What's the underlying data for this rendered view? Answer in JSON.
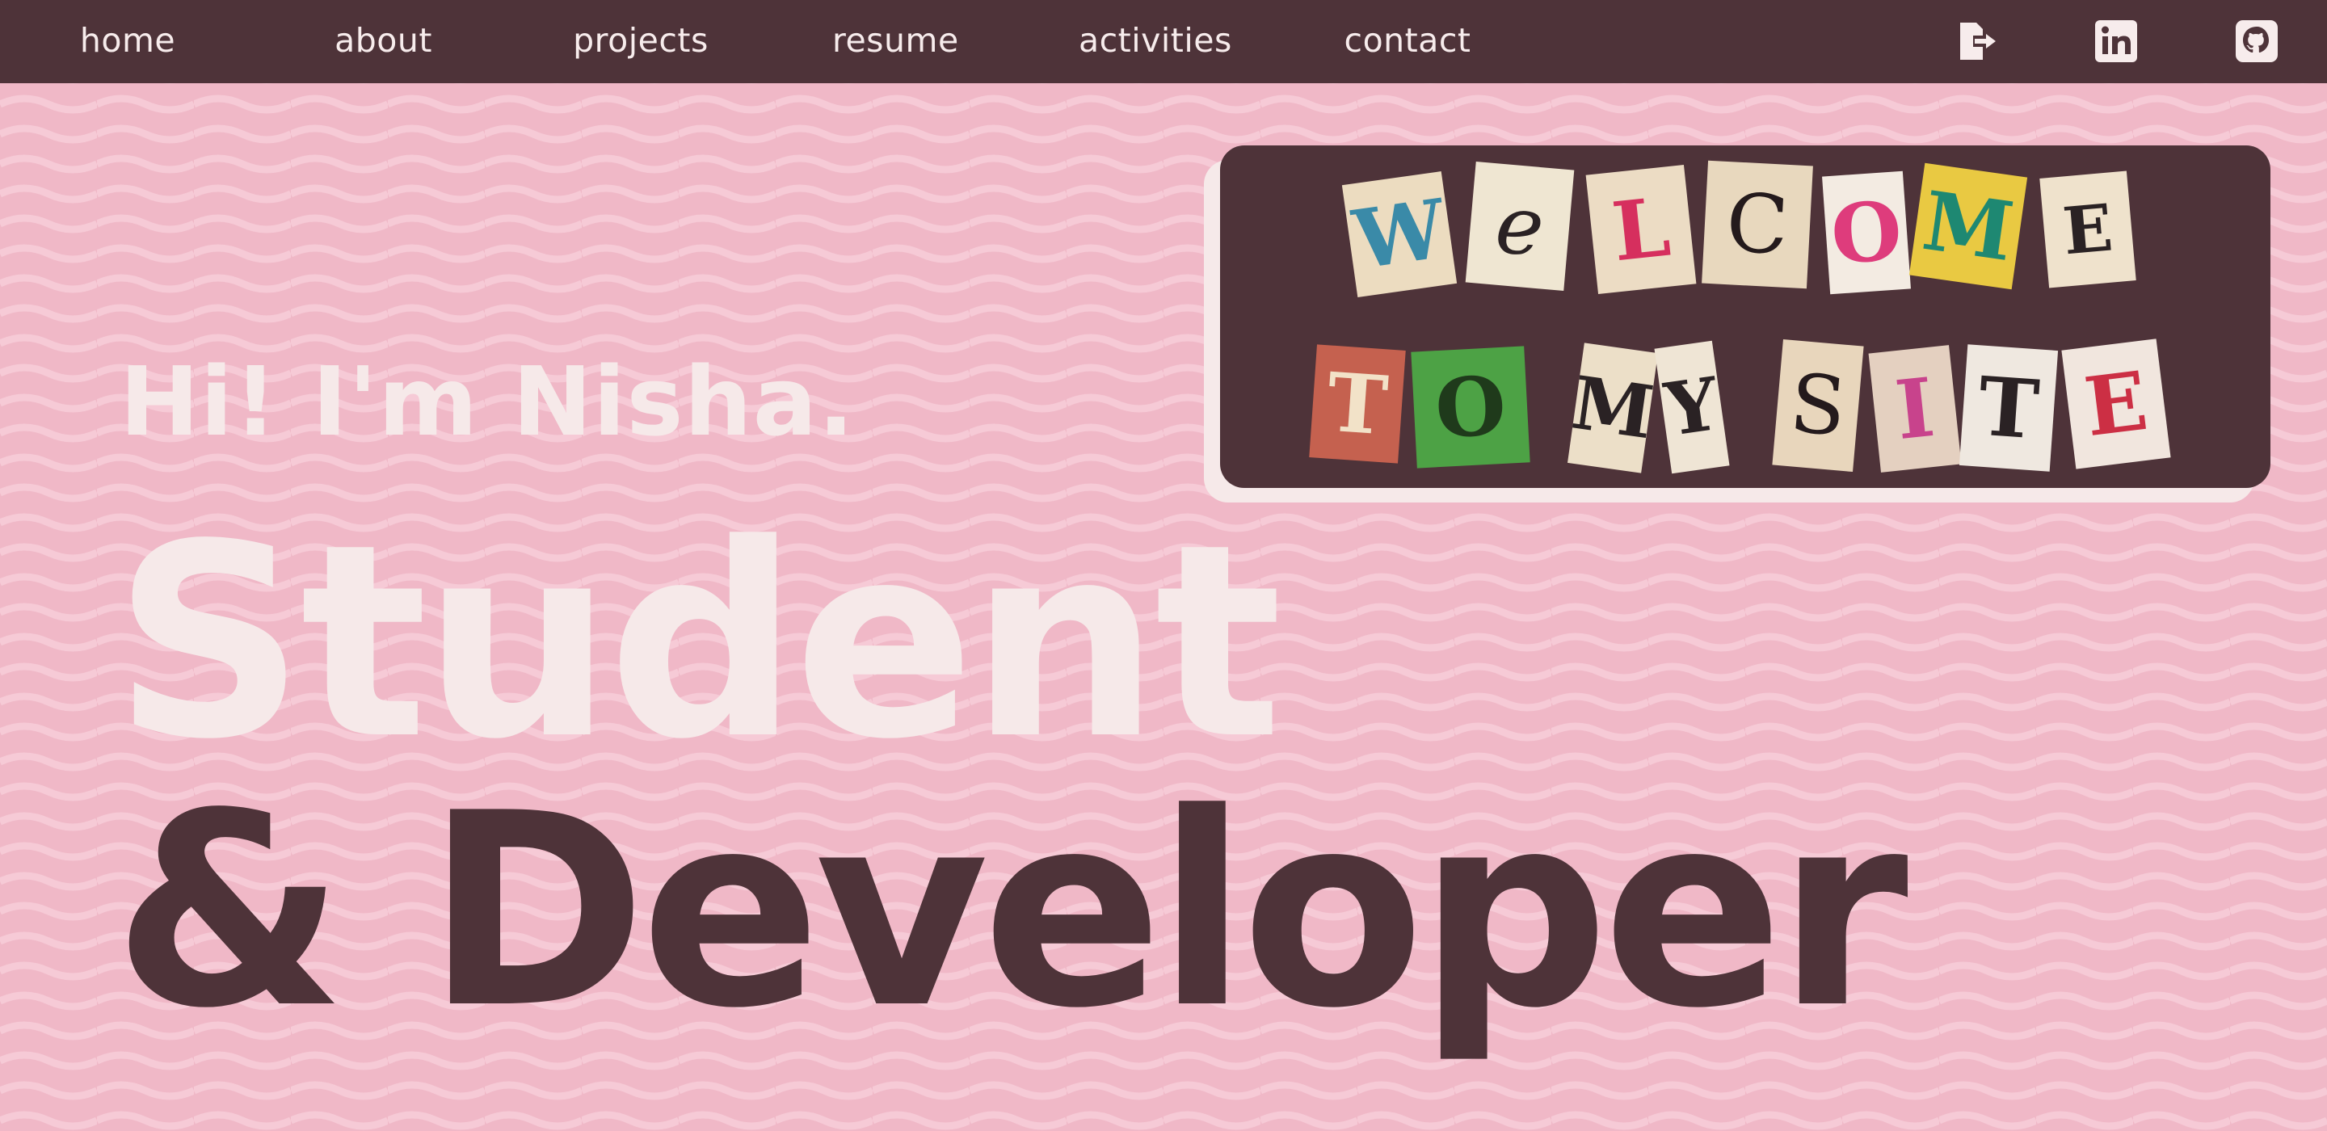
{
  "nav": {
    "links": [
      {
        "label": "home"
      },
      {
        "label": "about"
      },
      {
        "label": "projects"
      },
      {
        "label": "resume"
      },
      {
        "label": "activities"
      },
      {
        "label": "contact"
      }
    ],
    "icons": [
      "logout-icon",
      "linkedin-icon",
      "github-icon"
    ]
  },
  "welcome": {
    "row1": [
      "W",
      "e",
      "L",
      "C",
      "O",
      "M",
      "E"
    ],
    "row2": [
      "T",
      "O",
      "M",
      "Y",
      "S",
      "I",
      "T",
      "E"
    ]
  },
  "hero": {
    "greeting": "Hi! I'm Nisha.",
    "line1": "Student",
    "line2": "& Developer"
  },
  "colors": {
    "background": "#f0b8c7",
    "nav": "#4e3339",
    "text_light": "#f6e9e9",
    "text_dark": "#4e3339"
  }
}
